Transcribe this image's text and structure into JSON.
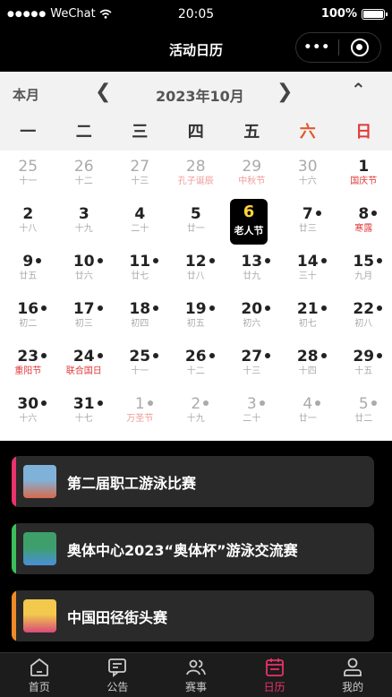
{
  "status": {
    "carrier": "WeChat",
    "signal": "●●●●●",
    "time": "20:05",
    "battery": "100%"
  },
  "nav": {
    "title": "活动日历",
    "more_icon": "•••",
    "close_icon": "record-close-icon"
  },
  "calendar": {
    "this_month_label": "本月",
    "prev_symbol": "❮",
    "next_symbol": "❯",
    "collapse_symbol": "⌃",
    "month_label": "2023年10月",
    "weekdays": [
      "一",
      "二",
      "三",
      "四",
      "五",
      "六",
      "日"
    ],
    "weeks": [
      [
        {
          "d": "25",
          "l": "十一",
          "g": true
        },
        {
          "d": "26",
          "l": "十二",
          "g": true
        },
        {
          "d": "27",
          "l": "十三",
          "g": true
        },
        {
          "d": "28",
          "l": "孔子诞辰",
          "g": true,
          "r": true
        },
        {
          "d": "29",
          "l": "中秋节",
          "g": true,
          "r": true
        },
        {
          "d": "30",
          "l": "十六",
          "g": true
        },
        {
          "d": "1",
          "l": "国庆节",
          "r": true
        }
      ],
      [
        {
          "d": "2",
          "l": "十八"
        },
        {
          "d": "3",
          "l": "十九"
        },
        {
          "d": "4",
          "l": "二十"
        },
        {
          "d": "5",
          "l": "廿一"
        },
        {
          "d": "6",
          "l": "老人节",
          "sel": true
        },
        {
          "d": "7",
          "l": "廿三",
          "dot": true
        },
        {
          "d": "8",
          "l": "寒露",
          "r": true,
          "dot": true
        }
      ],
      [
        {
          "d": "9",
          "l": "廿五",
          "dot": true
        },
        {
          "d": "10",
          "l": "廿六",
          "dot": true
        },
        {
          "d": "11",
          "l": "廿七",
          "dot": true
        },
        {
          "d": "12",
          "l": "廿八",
          "dot": true
        },
        {
          "d": "13",
          "l": "廿九",
          "dot": true
        },
        {
          "d": "14",
          "l": "三十",
          "dot": true
        },
        {
          "d": "15",
          "l": "九月",
          "dot": true
        }
      ],
      [
        {
          "d": "16",
          "l": "初二",
          "dot": true
        },
        {
          "d": "17",
          "l": "初三",
          "dot": true
        },
        {
          "d": "18",
          "l": "初四",
          "dot": true
        },
        {
          "d": "19",
          "l": "初五",
          "dot": true
        },
        {
          "d": "20",
          "l": "初六",
          "dot": true
        },
        {
          "d": "21",
          "l": "初七",
          "dot": true
        },
        {
          "d": "22",
          "l": "初八",
          "dot": true
        }
      ],
      [
        {
          "d": "23",
          "l": "重阳节",
          "r": true,
          "dot": true
        },
        {
          "d": "24",
          "l": "联合国日",
          "r": true,
          "dot": true
        },
        {
          "d": "25",
          "l": "十一",
          "dot": true
        },
        {
          "d": "26",
          "l": "十二",
          "dot": true
        },
        {
          "d": "27",
          "l": "十三",
          "dot": true
        },
        {
          "d": "28",
          "l": "十四",
          "dot": true
        },
        {
          "d": "29",
          "l": "十五",
          "dot": true
        }
      ],
      [
        {
          "d": "30",
          "l": "十六",
          "dot": true
        },
        {
          "d": "31",
          "l": "十七",
          "dot": true
        },
        {
          "d": "1",
          "l": "万圣节",
          "g": true,
          "r": true,
          "dot": true
        },
        {
          "d": "2",
          "l": "十九",
          "g": true,
          "dot": true
        },
        {
          "d": "3",
          "l": "二十",
          "g": true,
          "dot": true
        },
        {
          "d": "4",
          "l": "廿一",
          "g": true,
          "dot": true
        },
        {
          "d": "5",
          "l": "廿二",
          "g": true,
          "dot": true
        }
      ]
    ]
  },
  "events": [
    {
      "title": "第二届职工游泳比赛",
      "accent": "#e8336b",
      "thumb_colors": [
        "#7fb2d9",
        "#d86a4a"
      ]
    },
    {
      "title": "奥体中心2023“奥体杯”游泳交流赛",
      "accent": "#3cbf5a",
      "thumb_colors": [
        "#3e9f6a",
        "#4a8fd8"
      ]
    },
    {
      "title": "中国田径街头赛",
      "accent": "#f08a28",
      "thumb_colors": [
        "#f2c94c",
        "#d94a7a"
      ]
    }
  ],
  "tabs": [
    {
      "label": "首页",
      "icon": "home-icon"
    },
    {
      "label": "公告",
      "icon": "chat-icon"
    },
    {
      "label": "赛事",
      "icon": "people-icon"
    },
    {
      "label": "日历",
      "icon": "calendar-icon",
      "active": true
    },
    {
      "label": "我的",
      "icon": "profile-icon"
    }
  ],
  "colors": {
    "accent": "#e8336b",
    "weekend": "#e05a2b",
    "holiday": "#e03a3a",
    "selected_day": "#ffd43b"
  }
}
